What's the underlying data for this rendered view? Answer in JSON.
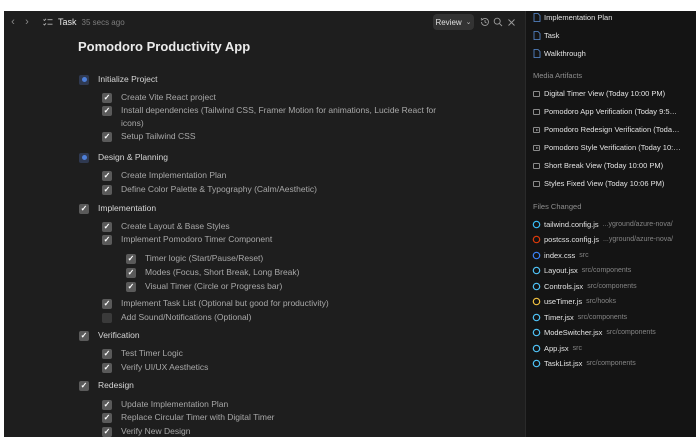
{
  "topbar": {
    "task_label": "Task",
    "time_ago": "35 secs ago",
    "review_label": "Review"
  },
  "title": "Pomodoro Productivity App",
  "checklist": [
    {
      "text": "Initialize Project",
      "level": 0,
      "state": "in_progress"
    },
    {
      "text": "Create Vite React project",
      "level": 1,
      "state": "done"
    },
    {
      "text": "Install dependencies (Tailwind CSS, Framer Motion for animations, Lucide React for icons)",
      "level": 1,
      "state": "done"
    },
    {
      "text": "Setup Tailwind CSS",
      "level": 1,
      "state": "done"
    },
    {
      "text": "Design & Planning",
      "level": 0,
      "state": "in_progress"
    },
    {
      "text": "Create Implementation Plan",
      "level": 1,
      "state": "done"
    },
    {
      "text": "Define Color Palette & Typography (Calm/Aesthetic)",
      "level": 1,
      "state": "done"
    },
    {
      "text": "Implementation",
      "level": 0,
      "state": "done"
    },
    {
      "text": "Create Layout & Base Styles",
      "level": 1,
      "state": "done"
    },
    {
      "text": "Implement Pomodoro Timer Component",
      "level": 1,
      "state": "done"
    },
    {
      "text": "Timer logic (Start/Pause/Reset)",
      "level": 2,
      "state": "done"
    },
    {
      "text": "Modes (Focus, Short Break, Long Break)",
      "level": 2,
      "state": "done"
    },
    {
      "text": "Visual Timer (Circle or Progress bar)",
      "level": 2,
      "state": "done"
    },
    {
      "text": "Implement Task List (Optional but good for productivity)",
      "level": 1,
      "state": "done"
    },
    {
      "text": "Add Sound/Notifications (Optional)",
      "level": 1,
      "state": "todo"
    },
    {
      "text": "Verification",
      "level": 0,
      "state": "done"
    },
    {
      "text": "Test Timer Logic",
      "level": 1,
      "state": "done"
    },
    {
      "text": "Verify UI/UX Aesthetics",
      "level": 1,
      "state": "done"
    },
    {
      "text": "Redesign",
      "level": 0,
      "state": "done"
    },
    {
      "text": "Update Implementation Plan",
      "level": 1,
      "state": "done"
    },
    {
      "text": "Replace Circular Timer with Digital Timer",
      "level": 1,
      "state": "done"
    },
    {
      "text": "Verify New Design",
      "level": 1,
      "state": "done"
    }
  ],
  "sidebar": {
    "artifacts": [
      {
        "label": "Implementation Plan",
        "icon": "document-icon"
      },
      {
        "label": "Task",
        "icon": "document-icon"
      },
      {
        "label": "Walkthrough",
        "icon": "document-icon"
      }
    ],
    "media_heading": "Media Artifacts",
    "media": [
      {
        "label": "Digital Timer View (Today 10:00 PM)",
        "icon": "image-icon"
      },
      {
        "label": "Pomodoro App Verification (Today 9:5…",
        "icon": "image-icon"
      },
      {
        "label": "Pomodoro Redesign Verification (Toda…",
        "icon": "video-icon"
      },
      {
        "label": "Pomodoro Style Verification (Today 10:…",
        "icon": "video-icon"
      },
      {
        "label": "Short Break View (Today 10:00 PM)",
        "icon": "image-icon"
      },
      {
        "label": "Styles Fixed View (Today 10:06 PM)",
        "icon": "image-icon"
      }
    ],
    "files_heading": "Files Changed",
    "files": [
      {
        "name": "tailwind.config.js",
        "path": "...yground/azure-nova/",
        "icon": "tailwind-icon",
        "color": "#38bdf8"
      },
      {
        "name": "postcss.config.js",
        "path": "...yground/azure-nova/",
        "icon": "postcss-icon",
        "color": "#dd3a0a"
      },
      {
        "name": "index.css",
        "path": "src",
        "icon": "css-icon",
        "color": "#3b82f6"
      },
      {
        "name": "Layout.jsx",
        "path": "src/components",
        "icon": "react-icon",
        "color": "#4fc3f7"
      },
      {
        "name": "Controls.jsx",
        "path": "src/components",
        "icon": "react-icon",
        "color": "#4fc3f7"
      },
      {
        "name": "useTimer.js",
        "path": "src/hooks",
        "icon": "hook-icon",
        "color": "#f0c040"
      },
      {
        "name": "Timer.jsx",
        "path": "src/components",
        "icon": "react-icon",
        "color": "#4fc3f7"
      },
      {
        "name": "ModeSwitcher.jsx",
        "path": "src/components",
        "icon": "react-icon",
        "color": "#4fc3f7"
      },
      {
        "name": "App.jsx",
        "path": "src",
        "icon": "react-icon",
        "color": "#4fc3f7"
      },
      {
        "name": "TaskList.jsx",
        "path": "src/components",
        "icon": "react-icon",
        "color": "#4fc3f7"
      }
    ]
  }
}
